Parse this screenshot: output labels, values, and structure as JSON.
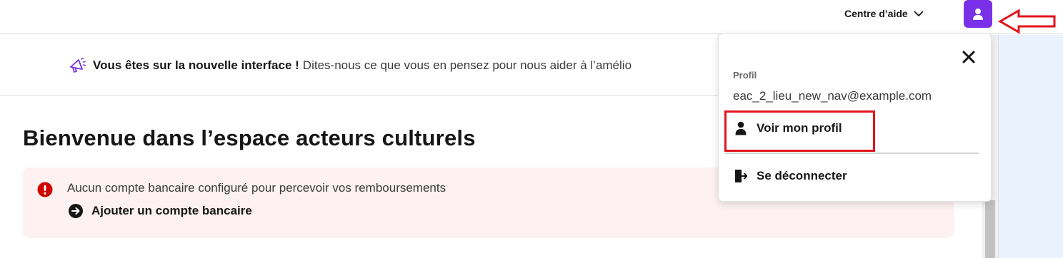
{
  "header": {
    "help_label": "Centre d’aide"
  },
  "banner": {
    "strong": "Vous êtes sur la nouvelle interface !",
    "text": "Dites-nous ce que vous en pensez pour nous aider à l’amélio"
  },
  "main": {
    "title": "Bienvenue dans l’espace acteurs culturels",
    "alert": {
      "message": "Aucun compte bancaire configuré pour percevoir vos remboursements",
      "link": "Ajouter un compte bancaire"
    }
  },
  "dropdown": {
    "section_label": "Profil",
    "email": "eac_2_lieu_new_nav@example.com",
    "profile_label": "Voir mon profil",
    "logout_label": "Se déconnecter"
  },
  "colors": {
    "accent": "#7a30e8",
    "alert_bg": "#fdf1f1",
    "alert_icon": "#ce0500",
    "annotation": "#e2141c"
  },
  "icons": [
    "chevron-down-icon",
    "user-icon",
    "megaphone-icon",
    "error-icon",
    "arrow-right-circle-icon",
    "close-icon",
    "logout-icon",
    "left-arrow-annotation"
  ]
}
